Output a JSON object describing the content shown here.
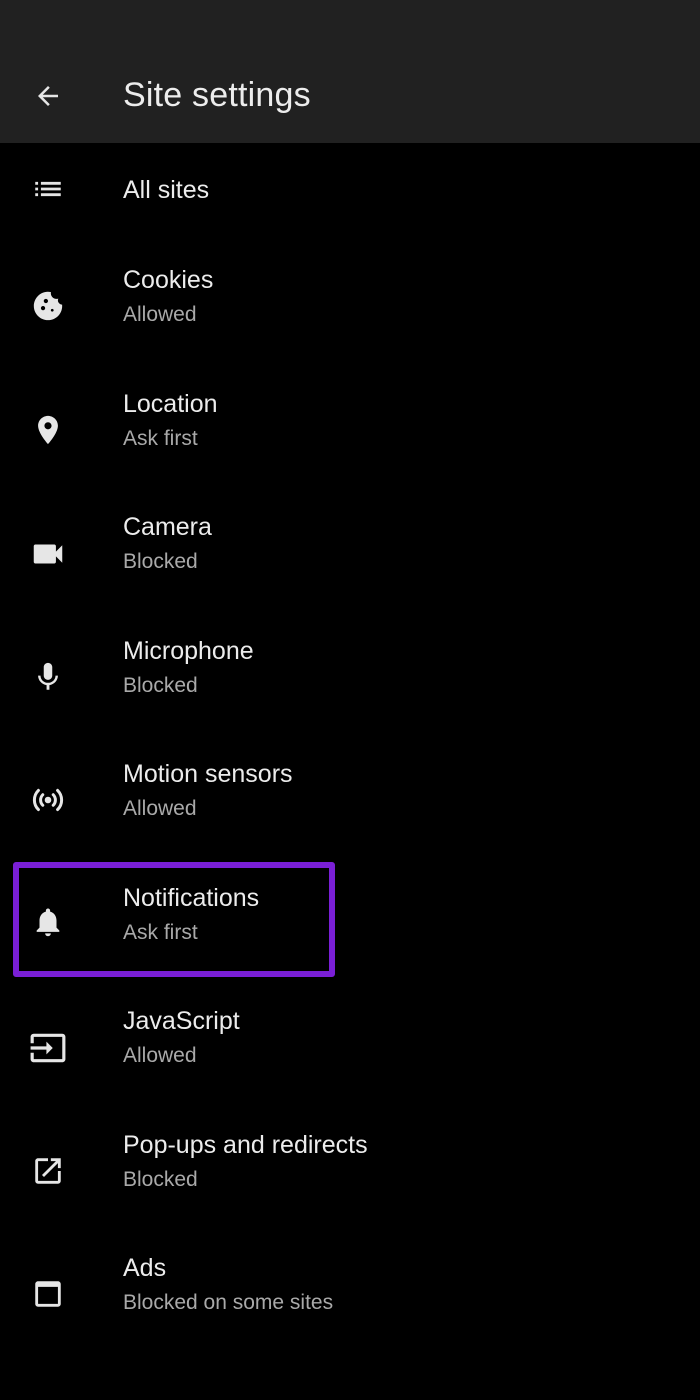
{
  "app_bar": {
    "title": "Site settings",
    "back_icon": "arrow-back-icon"
  },
  "items": [
    {
      "label": "All sites",
      "subtitle": "",
      "icon": "list-icon"
    },
    {
      "label": "Cookies",
      "subtitle": "Allowed",
      "icon": "cookie-icon"
    },
    {
      "label": "Location",
      "subtitle": "Ask first",
      "icon": "location-pin-icon"
    },
    {
      "label": "Camera",
      "subtitle": "Blocked",
      "icon": "videocam-icon"
    },
    {
      "label": "Microphone",
      "subtitle": "Blocked",
      "icon": "mic-icon"
    },
    {
      "label": "Motion sensors",
      "subtitle": "Allowed",
      "icon": "sensors-icon"
    },
    {
      "label": "Notifications",
      "subtitle": "Ask first",
      "icon": "bell-icon"
    },
    {
      "label": "JavaScript",
      "subtitle": "Allowed",
      "icon": "javascript-input-icon"
    },
    {
      "label": "Pop-ups and redirects",
      "subtitle": "Blocked",
      "icon": "external-link-icon"
    },
    {
      "label": "Ads",
      "subtitle": "Blocked on some sites",
      "icon": "window-icon"
    }
  ],
  "highlight": {
    "target": "Notifications",
    "color": "#7a1fd6"
  },
  "colors": {
    "app_bar_bg": "#212121",
    "background": "#000000",
    "primary_text": "#ececec",
    "secondary_text": "#a9a9a9"
  }
}
